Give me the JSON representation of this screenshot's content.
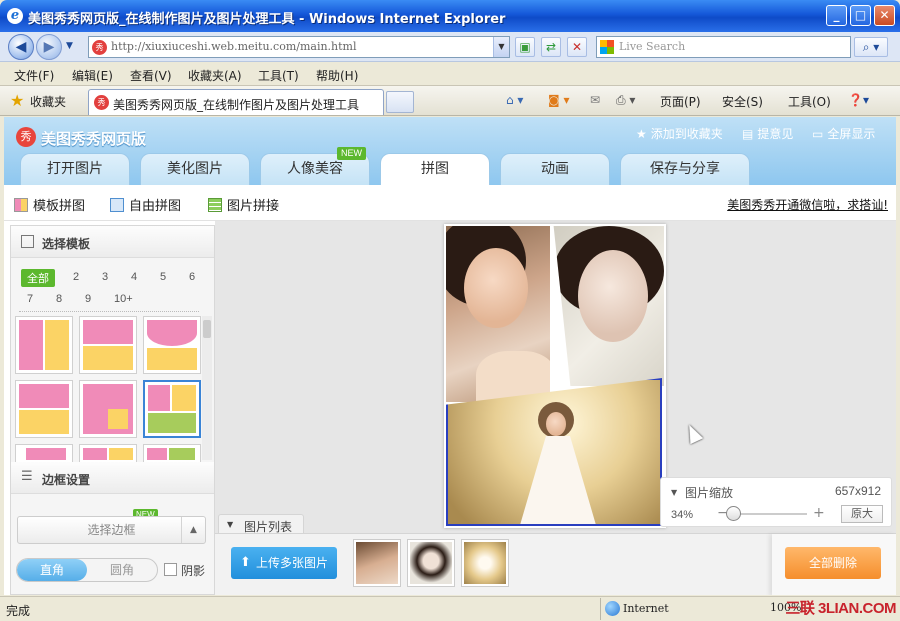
{
  "window": {
    "title": "美图秀秀网页版_在线制作图片及图片处理工具 - Windows Internet Explorer",
    "buttons": {
      "minimize": "_",
      "maximize": "□",
      "close": "✕"
    }
  },
  "navbar": {
    "url": "http://xiuxiuceshi.web.meitu.com/main.html",
    "search_placeholder": "Live Search"
  },
  "menu": [
    "文件(F)",
    "编辑(E)",
    "查看(V)",
    "收藏夹(A)",
    "工具(T)",
    "帮助(H)"
  ],
  "favbar": {
    "favorites_label": "收藏夹",
    "tab_title": "美图秀秀网页版_在线制作图片及图片处理工具",
    "commands": [
      "页面(P)",
      "安全(S)",
      "工具(O)"
    ]
  },
  "app": {
    "brand": "美图秀秀网页版",
    "head_links": {
      "bookmark": "添加到收藏夹",
      "feedback": "提意见",
      "fullscreen": "全屏显示"
    },
    "tabs": [
      "打开图片",
      "美化图片",
      "人像美容",
      "拼图",
      "动画",
      "保存与分享"
    ],
    "active_tab": "拼图",
    "new_badge": "NEW",
    "subtabs": [
      "模板拼图",
      "自由拼图",
      "图片拼接"
    ],
    "promo": "美图秀秀开通微信啦，求搭讪!",
    "template_panel": {
      "title": "选择模板",
      "counts_row1": [
        "全部",
        "2",
        "3",
        "4",
        "5",
        "6"
      ],
      "counts_row2": [
        "7",
        "8",
        "9",
        "10+"
      ]
    },
    "border_panel": {
      "title": "边框设置",
      "select_border": "选择边框",
      "new_badge": "NEW",
      "corner_square": "直角",
      "corner_round": "圆角",
      "shadow": "阴影"
    },
    "zoom": {
      "title": "图片缩放",
      "size": "657x912",
      "percent": "34%",
      "percent_value": 34,
      "minus": "−",
      "plus": "+",
      "original": "原大"
    },
    "image_list": {
      "tab_label": "图片列表",
      "upload": "上传多张图片",
      "delete_all": "全部删除"
    }
  },
  "statusbar": {
    "status": "完成",
    "zone": "Internet",
    "zoom": "100%",
    "watermark": "三联 3LIAN.COM"
  },
  "colors": {
    "accent_green": "#5cb82e",
    "upload_blue": "#228fdc",
    "delete_orange": "#f58e2c",
    "selection_blue": "#3a84d6"
  }
}
